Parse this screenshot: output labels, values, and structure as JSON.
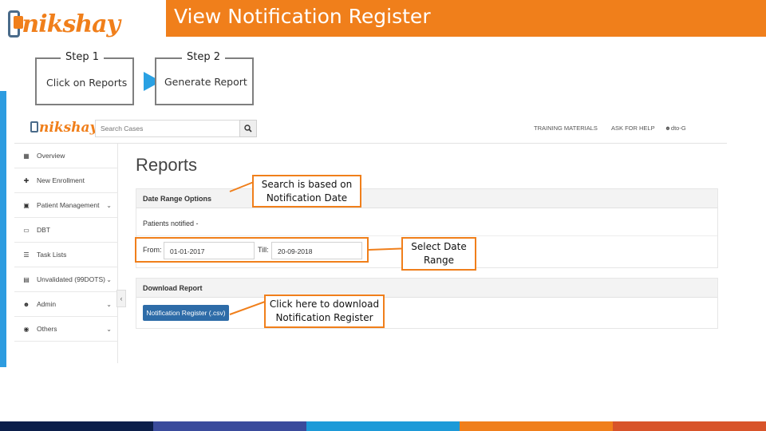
{
  "slide": {
    "brand": "nikshay",
    "title": "View Notification Register",
    "steps": [
      {
        "label": "Step 1",
        "text": "Click on Reports"
      },
      {
        "label": "Step 2",
        "text": "Generate Report"
      }
    ]
  },
  "app": {
    "brand": "nikshay",
    "search": {
      "placeholder": "Search Cases"
    },
    "header_links": [
      "TRAINING MATERIALS",
      "ASK FOR HELP",
      "dto-G"
    ],
    "sidebar": [
      {
        "label": "Overview",
        "icon": "overview-icon"
      },
      {
        "label": "New Enrollment",
        "icon": "plus-icon"
      },
      {
        "label": "Patient Management",
        "icon": "patient-icon"
      },
      {
        "label": "DBT",
        "icon": "dbt-icon"
      },
      {
        "label": "Task Lists",
        "icon": "list-icon"
      },
      {
        "label": "Unvalidated (99DOTS)",
        "icon": "unvalidated-icon"
      },
      {
        "label": "Admin",
        "icon": "user-icon"
      },
      {
        "label": "Others",
        "icon": "others-icon"
      }
    ],
    "page_title": "Reports",
    "date_range": {
      "heading": "Date Range Options",
      "patients_label": "Patients notified -",
      "from_label": "From:",
      "from_value": "01-01-2017",
      "till_label": "Till:",
      "till_value": "20-09-2018"
    },
    "download": {
      "heading": "Download Report",
      "button": "Notification Register (.csv)"
    }
  },
  "callouts": {
    "search_basis": [
      "Search is based on",
      "Notification Date"
    ],
    "select_range": [
      "Select Date",
      "Range"
    ],
    "download_hint": [
      "Click here to download",
      "Notification Register"
    ]
  },
  "colors": {
    "accent_orange": "#f07f1b",
    "accent_blue": "#2d9ce0",
    "button_blue": "#2e6ca8",
    "footer": [
      "#0b1e4a",
      "#3a4b9c",
      "#1d9ad8",
      "#f07f1b",
      "#d8542a"
    ]
  }
}
